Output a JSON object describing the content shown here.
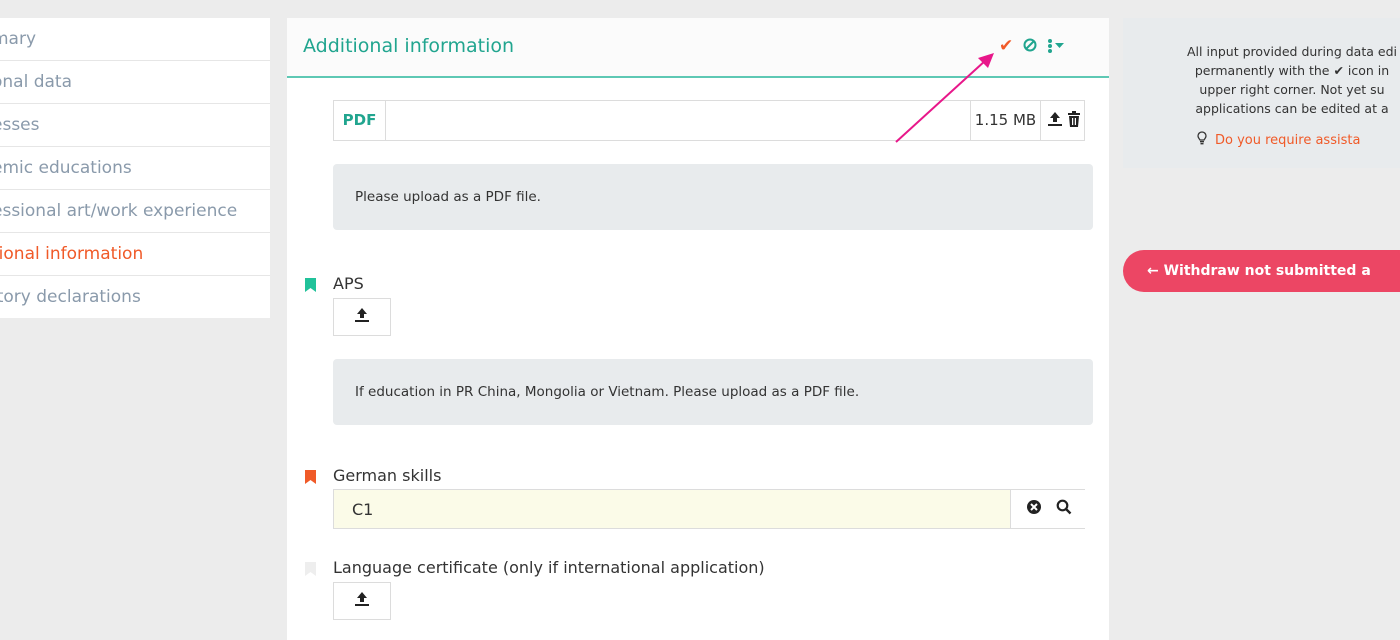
{
  "sidebar": {
    "items": [
      {
        "label": "mary",
        "active": false
      },
      {
        "label": "onal data",
        "active": false
      },
      {
        "label": "esses",
        "active": false
      },
      {
        "label": "emic educations",
        "active": false
      },
      {
        "label": "essional art/work experience",
        "active": false
      },
      {
        "label": "tional information",
        "active": true
      },
      {
        "label": "itory declarations",
        "active": false
      }
    ]
  },
  "panel": {
    "title": "Additional information",
    "header_icons": [
      "check-icon",
      "ban-icon",
      "menu-caret-icon"
    ]
  },
  "pdf_file": {
    "type": "PDF",
    "name": "",
    "size": "1.15 MB"
  },
  "hints": {
    "pdf": "Please upload as a PDF file.",
    "aps": "If education in PR China, Mongolia or Vietnam. Please upload as a PDF file."
  },
  "fields": {
    "aps": {
      "label": "APS",
      "bookmark_color": "#21c29a"
    },
    "german_skills": {
      "label": "German skills",
      "value": "C1",
      "bookmark_color": "#f05a28"
    },
    "language_certificate": {
      "label": "Language certificate (only if international application)",
      "bookmark_color": "#eeeeee"
    }
  },
  "info": {
    "lines": [
      "All input provided during data edi",
      "permanently with the ✔ icon in",
      "upper right corner. Not yet su",
      "applications can be edited at a"
    ],
    "assist": "Do you require assista"
  },
  "withdraw_button": {
    "label": "←  Withdraw not submitted a"
  },
  "colors": {
    "accent_teal": "#21a58f",
    "accent_orange": "#f05a28",
    "withdraw_red": "#ec4664",
    "annotation_arrow": "#e8178a"
  }
}
